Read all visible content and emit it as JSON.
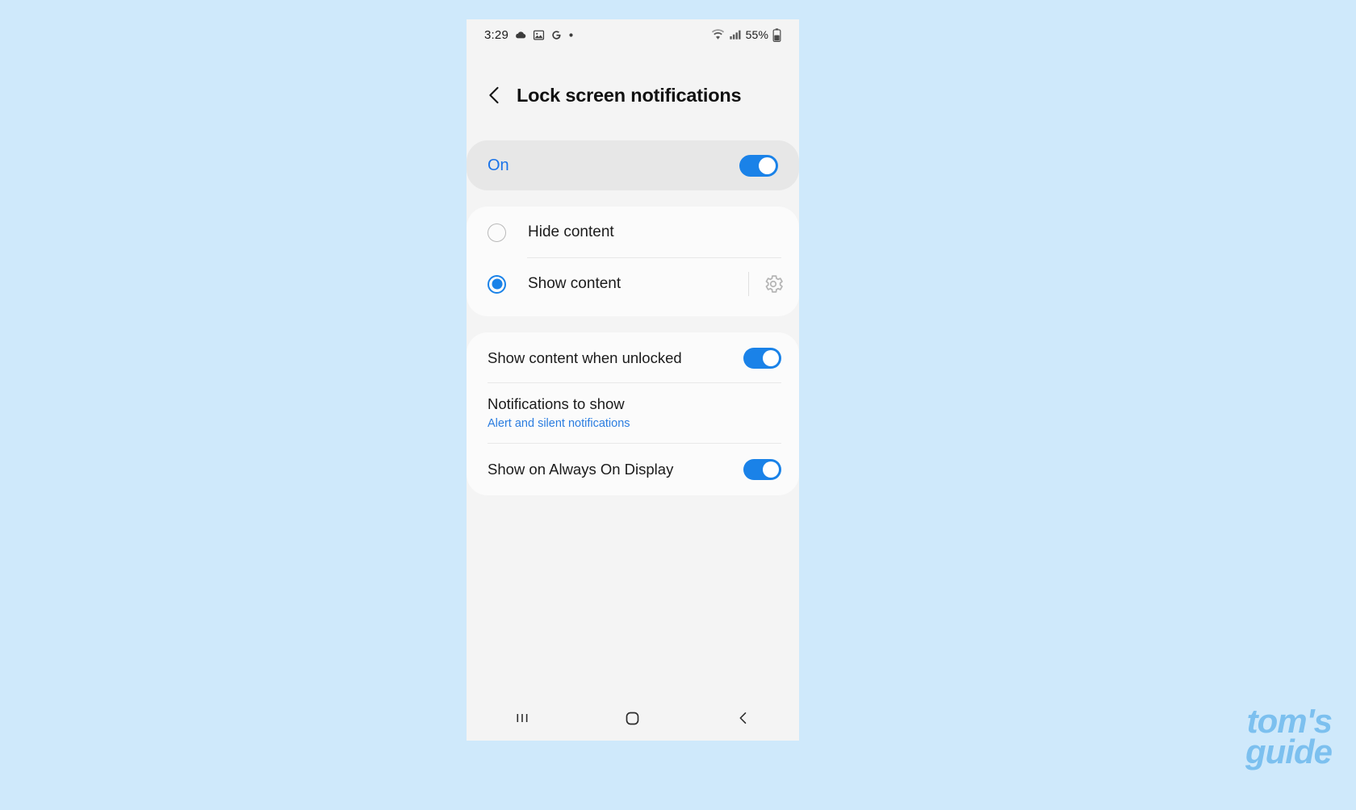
{
  "background_color": "#cfe9fb",
  "accent_color": "#1a82e8",
  "phone": {
    "status_bar": {
      "time": "3:29",
      "left_icons": [
        "cloud-icon",
        "photos-icon",
        "google-icon",
        "dot-icon"
      ],
      "right_icons": [
        "wifi-icon",
        "signal-icon",
        "battery-icon"
      ],
      "battery_percent": "55%"
    },
    "header": {
      "back_icon": "back-chevron-icon",
      "title": "Lock screen notifications"
    },
    "master_toggle": {
      "label": "On",
      "state": "on"
    },
    "content_options": {
      "options": [
        {
          "label": "Hide content",
          "selected": false
        },
        {
          "label": "Show content",
          "selected": true,
          "has_settings_gear": true
        }
      ]
    },
    "settings": {
      "rows": [
        {
          "title": "Show content when unlocked",
          "subtitle": "",
          "control": "toggle",
          "state": "on"
        },
        {
          "title": "Notifications to show",
          "subtitle": "Alert and silent notifications",
          "control": "none",
          "state": ""
        },
        {
          "title": "Show on Always On Display",
          "subtitle": "",
          "control": "toggle",
          "state": "on"
        }
      ]
    },
    "nav_bar": {
      "recents_icon": "recents-icon",
      "home_icon": "home-icon",
      "back_icon": "back-icon"
    }
  },
  "watermark": {
    "line1": "tom's",
    "line2": "guide",
    "color": "#7cc0ef"
  }
}
